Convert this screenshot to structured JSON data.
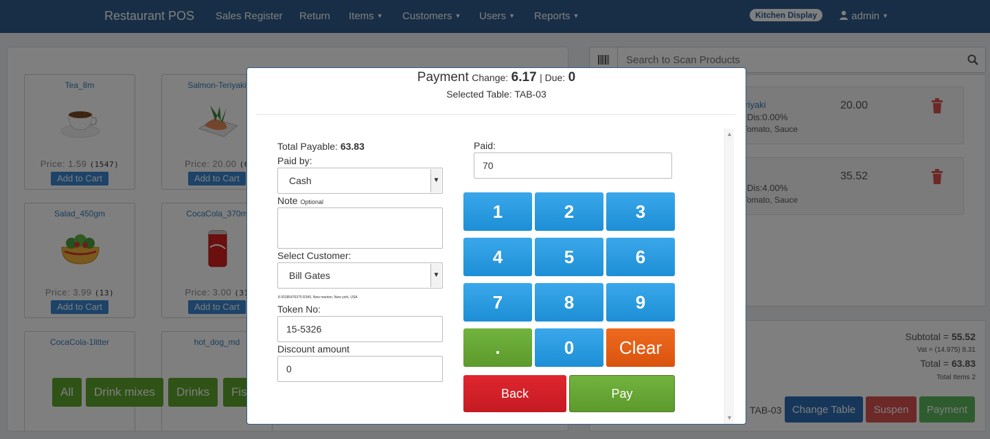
{
  "navbar": {
    "brand": "Restaurant POS",
    "links": [
      "Sales Register",
      "Return",
      "Items",
      "Customers",
      "Users",
      "Reports"
    ],
    "kitchen_display": "Kitchen Display",
    "user": "admin"
  },
  "products": [
    {
      "name": "Tea_8m",
      "price_label": "Price: 1.59",
      "stock": "(1547)",
      "button": "Add to Cart"
    },
    {
      "name": "Salmon-Teriyaki",
      "price_label": "Price: 20.00",
      "stock": "(6",
      "button": "Add to Cart"
    },
    {
      "name": "Salad_450gm",
      "price_label": "Price: 3.99",
      "stock": "(13)",
      "button": "Add to Cart"
    },
    {
      "name": "CocaCola_370m",
      "price_label": "Price: 3.00",
      "stock": "(31",
      "button": "Add to Cart"
    },
    {
      "name": "CocaCola-1litter"
    },
    {
      "name": "hot_dog_md"
    }
  ],
  "categories": [
    "All",
    "Drink mixes",
    "Drinks",
    "Fis"
  ],
  "search": {
    "placeholder": "Search to Scan Products"
  },
  "cart": {
    "items": [
      {
        "name": "eriyaki",
        "discount": "Dis:0.00%",
        "modifiers": "Tomato, Sauce",
        "price": "20.00"
      },
      {
        "name": "",
        "discount": "Dis:4.00%",
        "modifiers": "Tomato, Sauce",
        "price": "35.52"
      }
    ]
  },
  "totals": {
    "subtotal_label": "Subtotal =",
    "subtotal": "55.52",
    "vat_label": "Vat =",
    "vat_pct": "(14.975)",
    "vat": "8.31",
    "total_label": "Total =",
    "total": "63.83",
    "items_label": "Total Items",
    "items": "2"
  },
  "footer": {
    "table": "TAB-03",
    "change_table": "Change Table",
    "suspend": "Suspen",
    "payment": "Payment"
  },
  "modal": {
    "title": "Payment",
    "change_label": "Change:",
    "change": "6.17",
    "due_label": "| Due:",
    "due": "0",
    "selected_table_label": "Selected Table:",
    "selected_table": "TAB-03",
    "total_payable_label": "Total Payable:",
    "total_payable": "63.83",
    "paid_by_label": "Paid by:",
    "paid_by": "Cash",
    "note_label": "Note",
    "note_optional": "Optional",
    "note_value": "",
    "customer_label": "Select Customer:",
    "customer": "Bill Gates",
    "customer_info": "8 00185476375 R345, New manton, New york, USA",
    "token_label": "Token No:",
    "token": "15-5326",
    "discount_label": "Discount amount",
    "discount": "0",
    "paid_label": "Paid:",
    "paid": "70",
    "keys": [
      "1",
      "2",
      "3",
      "4",
      "5",
      "6",
      "7",
      "8",
      "9",
      ".",
      "0",
      "Clear"
    ],
    "back": "Back",
    "pay": "Pay"
  },
  "colors": {
    "navbar": "#2f5d8c",
    "key_blue": "#1d8fd6",
    "key_green": "#5c9a2c",
    "key_orange": "#d9530e",
    "back_red": "#d0202a",
    "pay_green": "#5c9a2c"
  }
}
